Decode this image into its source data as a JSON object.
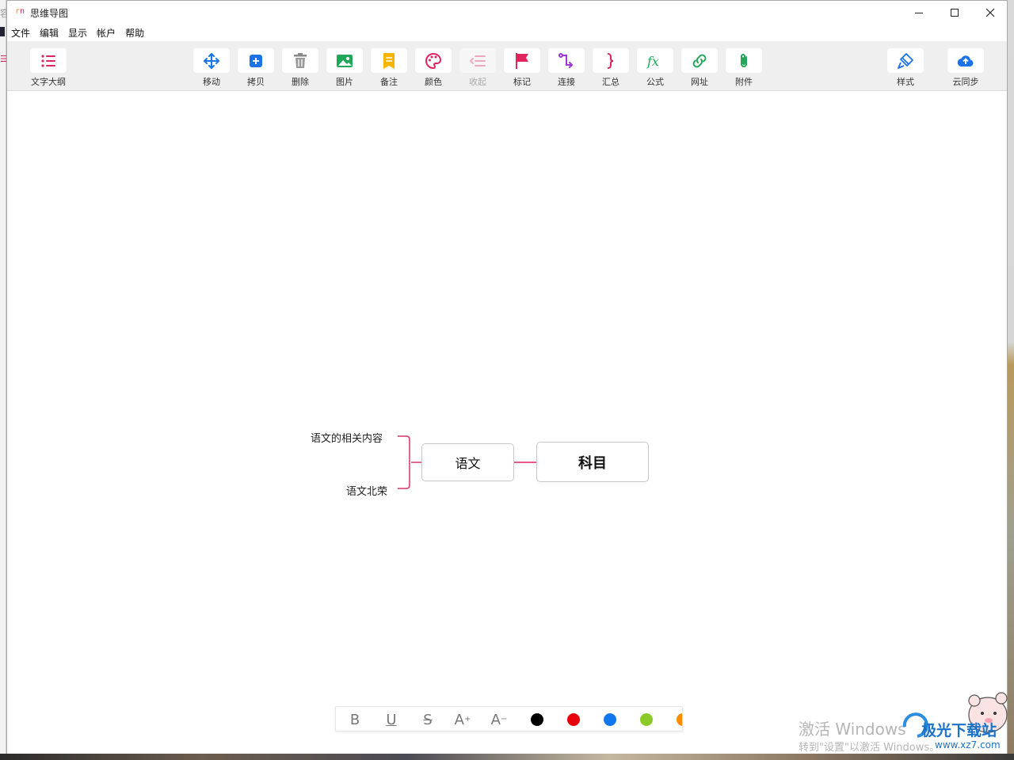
{
  "window": {
    "title": "思维导图"
  },
  "menu": [
    "文件",
    "编辑",
    "显示",
    "帐户",
    "帮助"
  ],
  "toolbar": {
    "outline": "文字大纲",
    "move": "移动",
    "copy": "拷贝",
    "delete": "删除",
    "image": "图片",
    "note": "备注",
    "color": "颜色",
    "collapse": "收起",
    "mark": "标记",
    "connect": "连接",
    "summary": "汇总",
    "formula": "公式",
    "url": "网址",
    "attachment": "附件",
    "style": "样式",
    "cloud_sync": "云同步"
  },
  "mindmap": {
    "root": "科目",
    "main_topic": "语文",
    "subtopics": [
      "语文的相关内容",
      "语文北荣"
    ]
  },
  "format_bar": {
    "bold": "B",
    "underline": "U",
    "strikethrough": "S",
    "grow": "A",
    "shrink": "A",
    "colors": [
      "#000000",
      "#e8000b",
      "#1177ee",
      "#8ac926",
      "#ff8c00"
    ]
  },
  "watermark": {
    "line1": "激活 Windows",
    "line2": "转到\"设置\"以激活 Windows。",
    "logo_text": "极光下载站",
    "logo_url": "www.xz7.com"
  }
}
